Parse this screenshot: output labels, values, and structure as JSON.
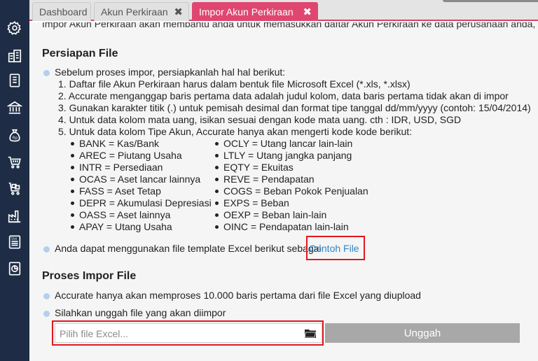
{
  "tabs": [
    {
      "label": "Dashboard"
    },
    {
      "label": "Akun Perkiraan",
      "close": "✖"
    },
    {
      "label": "Impor Akun Perkiraan",
      "close": "✖"
    }
  ],
  "intro_text": "Impor Akun Perkiraan akan membantu anda untuk memasukkan daftar Akun Perkiraan ke data perusahaan anda,",
  "prep": {
    "heading": "Persiapan File",
    "lead": "Sebelum proses impor, persiapkanlah hal hal berikut:",
    "steps": [
      "1. Daftar file Akun Perkiraan harus dalam bentuk file Microsoft Excel (*.xls, *.xlsx)",
      "2. Accurate menganggap baris pertama data adalah judul kolom, data baris pertama tidak akan di impor",
      "3. Gunakan karakter titik (.) untuk pemisah desimal dan format tipe tanggal dd/mm/yyyy (contoh: 15/04/2014)",
      "4. Untuk data kolom mata uang, isikan sesuai dengan kode mata uang. cth : IDR, USD, SGD",
      "5. Untuk data kolom Tipe Akun, Accurate hanya akan mengerti kode kode berikut:"
    ],
    "codes_left": [
      "BANK = Kas/Bank",
      "AREC = Piutang Usaha",
      "INTR = Persediaan",
      "OCAS = Aset lancar lainnya",
      "FASS = Aset Tetap",
      "DEPR = Akumulasi Depresiasi",
      "OASS = Aset lainnya",
      "APAY = Utang Usaha"
    ],
    "codes_right": [
      "OCLY = Utang lancar lain-lain",
      "LTLY = Utang jangka panjang",
      "EQTY = Ekuitas",
      "REVE = Pendapatan",
      "COGS = Beban Pokok Penjualan",
      "EXPS = Beban",
      "OEXP = Beban lain-lain",
      "OINC = Pendapatan lain-lain"
    ],
    "template_text": "Anda dapat menggunakan file template Excel berikut sebagai",
    "template_link": "Contoh File"
  },
  "process": {
    "heading": "Proses Impor File",
    "note1": "Accurate hanya akan memproses 10.000 baris pertama dari file Excel yang diupload",
    "note2": "Silahkan unggah file yang akan diimpor",
    "file_placeholder": "Pilih file Excel...",
    "upload_label": "Unggah"
  },
  "sidebar_icons": [
    "gear-icon",
    "buildings-icon",
    "ledger-icon",
    "bank-icon",
    "money-bag-icon",
    "cart-icon",
    "purchase-cart-icon",
    "factory-icon",
    "tax-icon",
    "report-icon"
  ],
  "colors": {
    "sidebar": "#1e2d45",
    "active_tab": "#df4770",
    "link": "#2e86c9",
    "highlight": "#e0181d",
    "button": "#a8a8a8"
  }
}
